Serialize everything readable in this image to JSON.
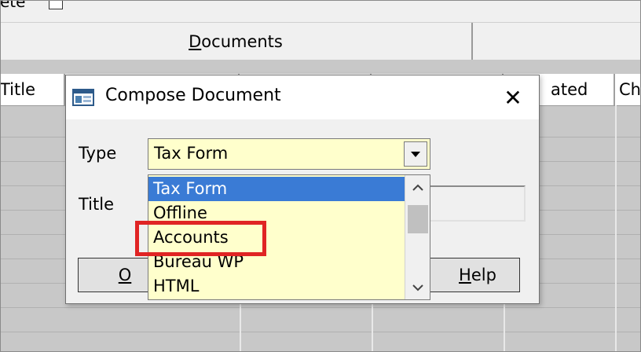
{
  "background": {
    "top_checkbox_label": "ete",
    "tabs": [
      {
        "label_pre": "",
        "label_u": "D",
        "label_post": "ocuments"
      },
      {
        "label_pre": "",
        "label_u": "",
        "label_post": ""
      }
    ],
    "grid": {
      "columns": [
        "Title",
        "",
        "",
        "",
        "ated",
        "Ch"
      ]
    }
  },
  "dialog": {
    "title": "Compose Document",
    "close_glyph": "✕",
    "type_label": "Type",
    "title_label": "Title",
    "type_value": "Tax Form",
    "dropdown_options": [
      "Tax Form",
      "Offline",
      "Accounts",
      "Bureau WP",
      "HTML"
    ],
    "selected_option": "Tax Form",
    "highlighted_option": "Accounts",
    "ok_button": {
      "u": "O",
      "rest": ""
    },
    "help_button": {
      "u": "H",
      "rest": "elp"
    }
  },
  "colors": {
    "selection": "#3a7bd5",
    "field_bg": "#ffffcc",
    "highlight": "#e02424"
  }
}
